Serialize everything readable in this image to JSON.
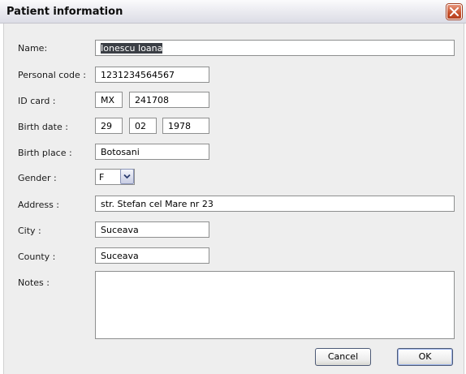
{
  "window": {
    "title": "Patient information",
    "close_icon": "close-icon"
  },
  "form": {
    "name": {
      "label": "Name:",
      "value": "Ionescu Ioana",
      "selected": true
    },
    "personal_code": {
      "label": "Personal code :",
      "value": "1231234564567"
    },
    "id_card": {
      "label": "ID card :",
      "series": "MX",
      "number": "241708"
    },
    "birth_date": {
      "label": "Birth date :",
      "day": "29",
      "month": "02",
      "year": "1978"
    },
    "birth_place": {
      "label": "Birth place :",
      "value": "Botosani"
    },
    "gender": {
      "label": "Gender :",
      "value": "F",
      "dropdown_icon": "chevron-down-icon"
    },
    "address": {
      "label": "Address :",
      "value": "str. Stefan cel Mare nr 23"
    },
    "city": {
      "label": "City :",
      "value": "Suceava"
    },
    "county": {
      "label": "County :",
      "value": "Suceava"
    },
    "notes": {
      "label": "Notes :",
      "value": ""
    }
  },
  "buttons": {
    "cancel": "Cancel",
    "ok": "OK"
  },
  "colors": {
    "close_button": "#c7502b",
    "selection": "#3b3f45",
    "dialog_background": "#eeeeee"
  }
}
